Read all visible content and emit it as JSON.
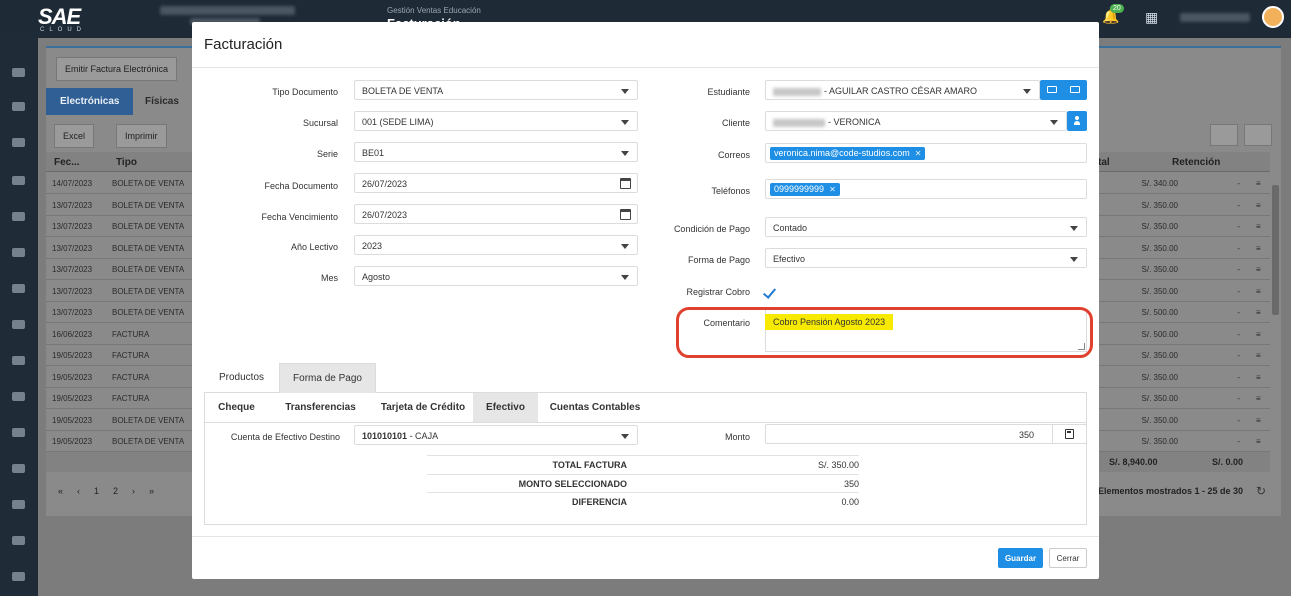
{
  "app": {
    "logo": "SAE",
    "logo_sub": "CLOUD",
    "module_subtitle": "Gestión Ventas Educación",
    "module_title": "Facturación",
    "notification_count": "20"
  },
  "background": {
    "emit_button": "Emitir Factura Electrónica",
    "tabs": [
      "Electrónicas",
      "Físicas"
    ],
    "toolbar": {
      "excel": "Excel",
      "print": "Imprimir"
    },
    "columns": {
      "fecha": "Fec...",
      "tipo": "Tipo",
      "total": "tal",
      "retencion": "Retención"
    },
    "rows": [
      {
        "fecha": "14/07/2023",
        "tipo": "BOLETA DE VENTA",
        "total": "S/. 340.00",
        "ret": "-"
      },
      {
        "fecha": "13/07/2023",
        "tipo": "BOLETA DE VENTA",
        "total": "S/. 350.00",
        "ret": "-"
      },
      {
        "fecha": "13/07/2023",
        "tipo": "BOLETA DE VENTA",
        "total": "S/. 350.00",
        "ret": "-"
      },
      {
        "fecha": "13/07/2023",
        "tipo": "BOLETA DE VENTA",
        "total": "S/. 350.00",
        "ret": "-"
      },
      {
        "fecha": "13/07/2023",
        "tipo": "BOLETA DE VENTA",
        "total": "S/. 350.00",
        "ret": "-"
      },
      {
        "fecha": "13/07/2023",
        "tipo": "BOLETA DE VENTA",
        "total": "S/. 350.00",
        "ret": "-"
      },
      {
        "fecha": "13/07/2023",
        "tipo": "BOLETA DE VENTA",
        "total": "S/. 500.00",
        "ret": "-"
      },
      {
        "fecha": "16/06/2023",
        "tipo": "FACTURA",
        "total": "S/. 500.00",
        "ret": "-"
      },
      {
        "fecha": "19/05/2023",
        "tipo": "FACTURA",
        "total": "S/. 350.00",
        "ret": "-"
      },
      {
        "fecha": "19/05/2023",
        "tipo": "FACTURA",
        "total": "S/. 350.00",
        "ret": "-"
      },
      {
        "fecha": "19/05/2023",
        "tipo": "FACTURA",
        "total": "S/. 350.00",
        "ret": "-"
      },
      {
        "fecha": "19/05/2023",
        "tipo": "BOLETA DE VENTA",
        "total": "S/. 350.00",
        "ret": "-"
      },
      {
        "fecha": "19/05/2023",
        "tipo": "BOLETA DE VENTA",
        "total": "S/. 350.00",
        "ret": "-"
      }
    ],
    "footer": {
      "total": "S/. 8,940.00",
      "ret": "S/. 0.00"
    },
    "pager": [
      "1",
      "2"
    ],
    "elements_shown": "Elementos mostrados 1 - 25 de 30"
  },
  "modal": {
    "title": "Facturación",
    "left": {
      "tipo_documento": {
        "label": "Tipo Documento",
        "value": "BOLETA DE VENTA"
      },
      "sucursal": {
        "label": "Sucursal",
        "value": "001 (SEDE LIMA)"
      },
      "serie": {
        "label": "Serie",
        "value": "BE01"
      },
      "fecha_documento": {
        "label": "Fecha Documento",
        "value": "26/07/2023"
      },
      "fecha_vencimiento": {
        "label": "Fecha Vencimiento",
        "value": "26/07/2023"
      },
      "anio_lectivo": {
        "label": "Año Lectivo",
        "value": "2023"
      },
      "mes": {
        "label": "Mes",
        "value": "Agosto"
      }
    },
    "right": {
      "estudiante": {
        "label": "Estudiante",
        "value": "- AGUILAR CASTRO CÉSAR AMARO"
      },
      "cliente": {
        "label": "Cliente",
        "value": "- VERONICA"
      },
      "correos": {
        "label": "Correos",
        "tag": "veronica.nima@code-studios.com"
      },
      "telefonos": {
        "label": "Teléfonos",
        "tag": "0999999999"
      },
      "condicion_pago": {
        "label": "Condición de Pago",
        "value": "Contado"
      },
      "forma_pago": {
        "label": "Forma de Pago",
        "value": "Efectivo"
      },
      "registrar_cobro": {
        "label": "Registrar Cobro",
        "checked": true
      },
      "comentario": {
        "label": "Comentario",
        "value": "Cobro Pensión Agosto 2023"
      }
    },
    "tabs": [
      "Productos",
      "Forma de Pago"
    ],
    "payment_tabs": [
      "Cheque",
      "Transferencias",
      "Tarjeta de Crédito",
      "Efectivo",
      "Cuentas Contables"
    ],
    "cuenta_efectivo": {
      "label": "Cuenta de Efectivo Destino",
      "code": "101010101",
      "name": " - CAJA"
    },
    "monto": {
      "label": "Monto",
      "value": "350"
    },
    "summary": [
      {
        "label": "TOTAL FACTURA",
        "value": "S/. 350.00"
      },
      {
        "label": "MONTO SELECCIONADO",
        "value": "350"
      },
      {
        "label": "DIFERENCIA",
        "value": "0.00"
      }
    ],
    "buttons": {
      "save": "Guardar",
      "close": "Cerrar"
    }
  }
}
